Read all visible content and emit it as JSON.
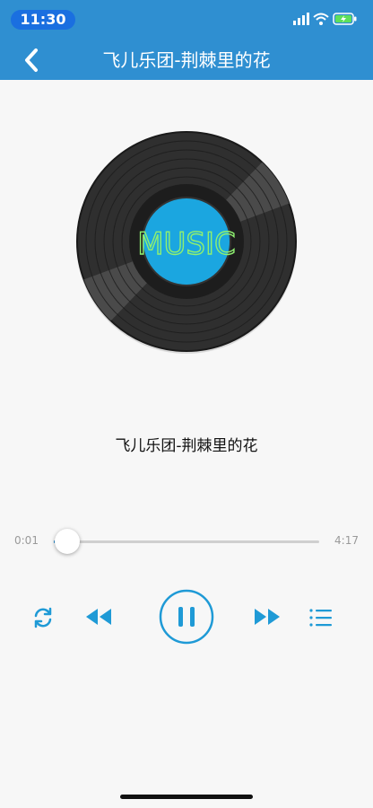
{
  "status_bar": {
    "time": "11:30"
  },
  "nav": {
    "title": "飞儿乐团-荆棘里的花"
  },
  "album_art": {
    "label": "MUSIC"
  },
  "song": {
    "title": "飞儿乐团-荆棘里的花"
  },
  "progress": {
    "current": "0:01",
    "total": "4:17",
    "fraction": 0.004
  },
  "controls": {
    "repeat_icon": "repeat-icon",
    "prev_icon": "rewind-icon",
    "play_pause_icon": "pause-icon",
    "next_icon": "fast-forward-icon",
    "playlist_icon": "playlist-icon"
  },
  "colors": {
    "header": "#2f8fd1",
    "accent": "#1f9ad6",
    "label_bg": "#1ba6e0"
  }
}
